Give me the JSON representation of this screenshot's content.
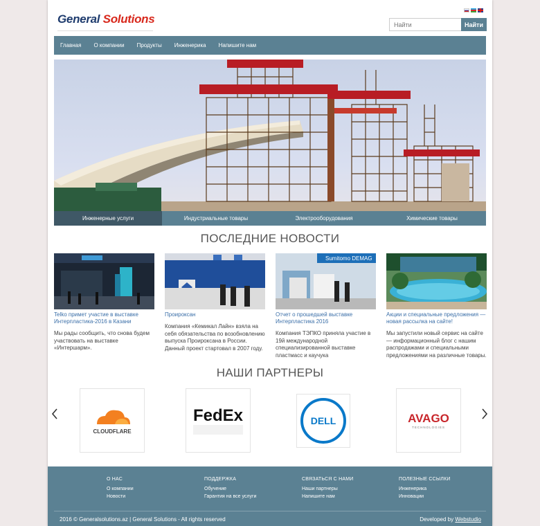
{
  "header": {
    "logo_part1": "General",
    "logo_part2": "Solutions",
    "search_placeholder": "Найти",
    "search_button": "Найти",
    "languages": [
      "ru",
      "az",
      "en"
    ]
  },
  "nav": {
    "items": [
      "Главная",
      "О компании",
      "Продукты",
      "Инженерика",
      "Напишите нам"
    ]
  },
  "hero": {
    "tabs": [
      "Инженерные услуги",
      "Индустриальные товары",
      "Электрооборудования",
      "Химические товары"
    ],
    "active_tab": 0
  },
  "news": {
    "title": "ПОСЛЕДНИЕ НОВОСТИ",
    "items": [
      {
        "title": "Telko примет участие в выставке Интерпластика-2016 в Казани",
        "text": "Мы рады сообщить, что снова будем участвовать на выставке «Интершарм»."
      },
      {
        "title": "Проироксан",
        "text": "Компания «Кемикал Лайн» взяла на себя обязательства по возобновлению выпуска Проироксана в России. Данный проект стартовал в 2007 году."
      },
      {
        "title": "Отчет о прошедшей выставке Интерпластика 2016",
        "text": "Компания ТЭПКО приняла участие в 19й международной специализированной выставке пластмасс и каучука"
      },
      {
        "title": "Акции и специальные предложения — новая рассылка на сайте!",
        "text": "Мы запустили новый сервис на сайте — информационный блог с нашим распродажами и специальными предложениями на различные товары."
      }
    ]
  },
  "partners": {
    "title": "НАШИ ПАРТНЕРЫ",
    "logos": [
      "CLOUDFLARE",
      "FedEx",
      "DELL",
      "AVAGO"
    ],
    "avago_sub": "TECHNOLOGIES",
    "prev_icon": "chevron-left-icon",
    "next_icon": "chevron-right-icon"
  },
  "footer": {
    "columns": [
      {
        "heading": "О НАС",
        "links": [
          "О компании",
          "Новости"
        ]
      },
      {
        "heading": "ПОДДЕРЖКА",
        "links": [
          "Обучение",
          "Гарантия на все услуги"
        ]
      },
      {
        "heading": "СВЯЗАТЬСЯ С НАМИ",
        "links": [
          "Наши партнеры",
          "Напишите нам"
        ]
      },
      {
        "heading": "ПОЛЕЗНЫЕ ССЫЛКИ",
        "links": [
          "Инженерика",
          "Инновации"
        ]
      }
    ],
    "copyright": "2016 © Generalsolutions.az | General Solutions - All rights reserved",
    "developed_by": "Developed by",
    "developer": "Webstudio"
  },
  "colors": {
    "accent": "#5b8193",
    "accent_dark": "#3f5866",
    "link": "#3b6fa8",
    "logo_blue": "#1f3c6e",
    "logo_red": "#d8281c"
  }
}
